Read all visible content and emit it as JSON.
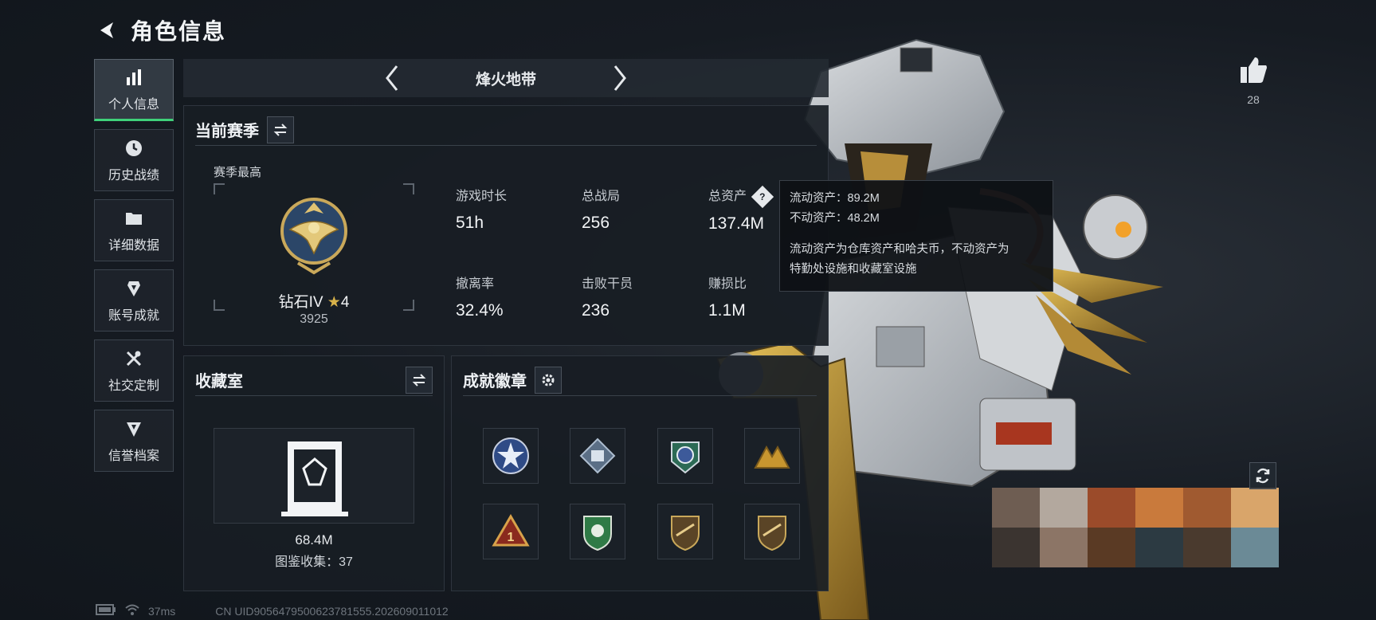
{
  "header": {
    "title": "角色信息"
  },
  "sidebar": {
    "items": [
      {
        "label": "个人信息",
        "icon": "bar-chart-icon",
        "active": true
      },
      {
        "label": "历史战绩",
        "icon": "clock-icon"
      },
      {
        "label": "详细数据",
        "icon": "folder-icon"
      },
      {
        "label": "账号成就",
        "icon": "trophy-icon"
      },
      {
        "label": "社交定制",
        "icon": "tools-icon"
      },
      {
        "label": "信誉档案",
        "icon": "shield-icon"
      }
    ]
  },
  "mode": {
    "title": "烽火地带"
  },
  "season": {
    "title": "当前赛季",
    "best_label": "赛季最高",
    "rank": {
      "name": "钻石IV",
      "stars": "4",
      "score": "3925"
    },
    "stats": [
      {
        "key": "游戏时长",
        "value": "51h"
      },
      {
        "key": "总战局",
        "value": "256"
      },
      {
        "key": "总资产",
        "value": "137.4M"
      },
      {
        "key": "撤离率",
        "value": "32.4%"
      },
      {
        "key": "击败干员",
        "value": "236"
      },
      {
        "key": "赚损比",
        "value": "1.1M"
      }
    ]
  },
  "tooltip": {
    "liquid": "流动资产：89.2M",
    "fixed": "不动资产：48.2M",
    "desc_line1": "流动资产为仓库资产和哈夫币，不动资产为",
    "desc_line2": "特勤处设施和收藏室设施"
  },
  "collection": {
    "title": "收藏室",
    "value": "68.4M",
    "count": "图鉴收集：37"
  },
  "achievements": {
    "title": "成就徽章",
    "badges": [
      "star-emblem-icon",
      "diamond-emblem-icon",
      "globe-emblem-icon",
      "mountain-emblem-icon",
      "triangle-one-emblem-icon",
      "lion-shield-emblem-icon",
      "rifle-shield-emblem-icon",
      "rifle-shield-emblem-icon"
    ]
  },
  "social": {
    "likes": "28"
  },
  "status": {
    "ping": "37ms",
    "uid": "CN UID9056479500623781555.202609011012"
  },
  "colors": {
    "accent": "#3fd17a",
    "gold": "#d8b24a",
    "panel": "#181d24"
  }
}
